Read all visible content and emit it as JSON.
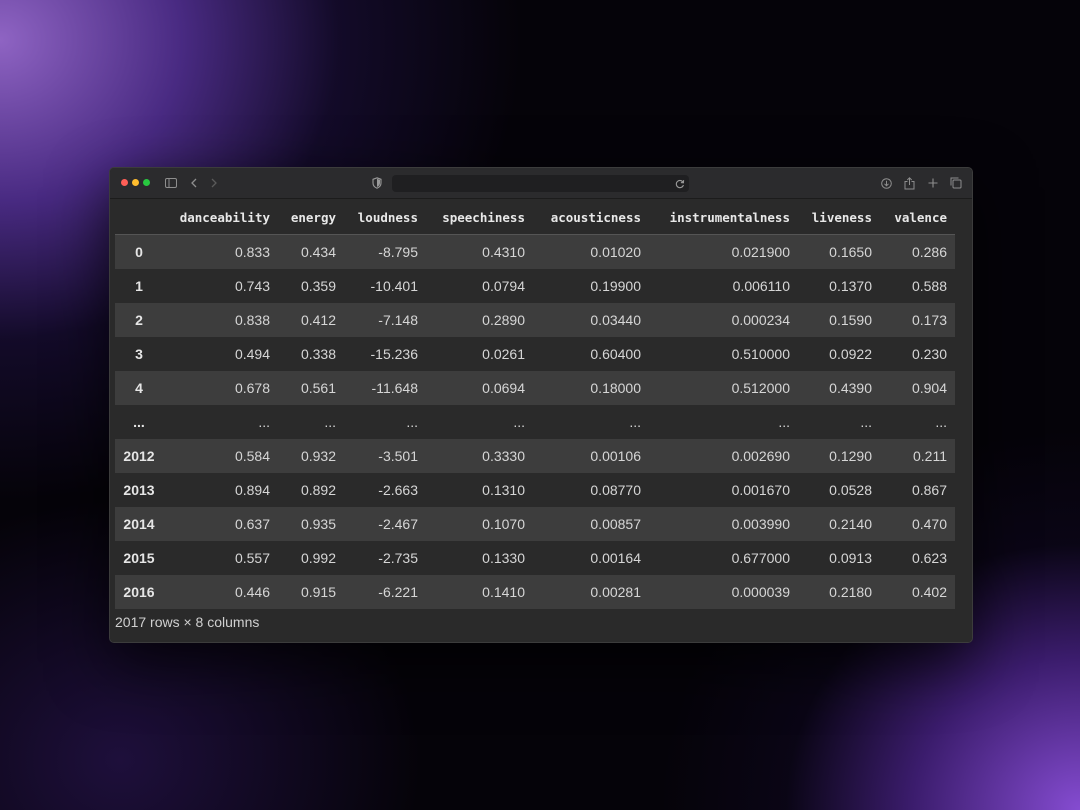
{
  "colors": {
    "traffic_close": "#ff5f57",
    "traffic_minimize": "#febc2e",
    "traffic_zoom": "#28c840",
    "odd_row": "#3d3d3d",
    "even_row": "#2a2a2a"
  },
  "toolbar": {
    "sidebar_icon": "sidebar-icon",
    "back_icon": "chevron-left-icon",
    "forward_icon": "chevron-right-icon",
    "shield_icon": "shield-icon",
    "reload_icon": "reload-icon",
    "download_icon": "download-icon",
    "share_icon": "share-icon",
    "new_tab_icon": "plus-icon",
    "tabs_icon": "tabs-overview-icon",
    "address": ""
  },
  "table": {
    "columns": [
      "",
      "danceability",
      "energy",
      "loudness",
      "speechiness",
      "acousticness",
      "instrumentalness",
      "liveness",
      "valence"
    ],
    "rows": [
      [
        "0",
        "0.833",
        "0.434",
        "-8.795",
        "0.4310",
        "0.01020",
        "0.021900",
        "0.1650",
        "0.286"
      ],
      [
        "1",
        "0.743",
        "0.359",
        "-10.401",
        "0.0794",
        "0.19900",
        "0.006110",
        "0.1370",
        "0.588"
      ],
      [
        "2",
        "0.838",
        "0.412",
        "-7.148",
        "0.2890",
        "0.03440",
        "0.000234",
        "0.1590",
        "0.173"
      ],
      [
        "3",
        "0.494",
        "0.338",
        "-15.236",
        "0.0261",
        "0.60400",
        "0.510000",
        "0.0922",
        "0.230"
      ],
      [
        "4",
        "0.678",
        "0.561",
        "-11.648",
        "0.0694",
        "0.18000",
        "0.512000",
        "0.4390",
        "0.904"
      ],
      [
        "...",
        "...",
        "...",
        "...",
        "...",
        "...",
        "...",
        "...",
        "..."
      ],
      [
        "2012",
        "0.584",
        "0.932",
        "-3.501",
        "0.3330",
        "0.00106",
        "0.002690",
        "0.1290",
        "0.211"
      ],
      [
        "2013",
        "0.894",
        "0.892",
        "-2.663",
        "0.1310",
        "0.08770",
        "0.001670",
        "0.0528",
        "0.867"
      ],
      [
        "2014",
        "0.637",
        "0.935",
        "-2.467",
        "0.1070",
        "0.00857",
        "0.003990",
        "0.2140",
        "0.470"
      ],
      [
        "2015",
        "0.557",
        "0.992",
        "-2.735",
        "0.1330",
        "0.00164",
        "0.677000",
        "0.0913",
        "0.623"
      ],
      [
        "2016",
        "0.446",
        "0.915",
        "-6.221",
        "0.1410",
        "0.00281",
        "0.000039",
        "0.2180",
        "0.402"
      ]
    ]
  },
  "footer": {
    "summary": "2017 rows × 8 columns"
  }
}
